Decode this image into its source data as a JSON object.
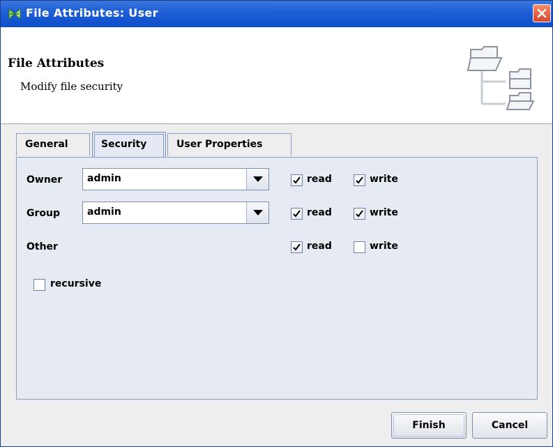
{
  "window": {
    "title": "File Attributes: User"
  },
  "header": {
    "title": "File Attributes",
    "subtitle": "Modify file security",
    "icon": "folder-tree-icon"
  },
  "tabs": [
    {
      "label": "General",
      "active": false
    },
    {
      "label": "Security",
      "active": true
    },
    {
      "label": "User Properties",
      "active": false
    }
  ],
  "security": {
    "owner": {
      "label": "Owner",
      "value": "admin",
      "read_label": "read",
      "read": true,
      "write_label": "write",
      "write": true
    },
    "group": {
      "label": "Group",
      "value": "admin",
      "read_label": "read",
      "read": true,
      "write_label": "write",
      "write": true
    },
    "other": {
      "label": "Other",
      "read_label": "read",
      "read": true,
      "write_label": "write",
      "write": false
    },
    "recursive": {
      "label": "recursive",
      "checked": false
    }
  },
  "buttons": {
    "finish": "Finish",
    "cancel": "Cancel"
  },
  "colors": {
    "titlebar": "#0d4fcb",
    "panel": "#e6ebf3",
    "window": "#eeeeee"
  }
}
